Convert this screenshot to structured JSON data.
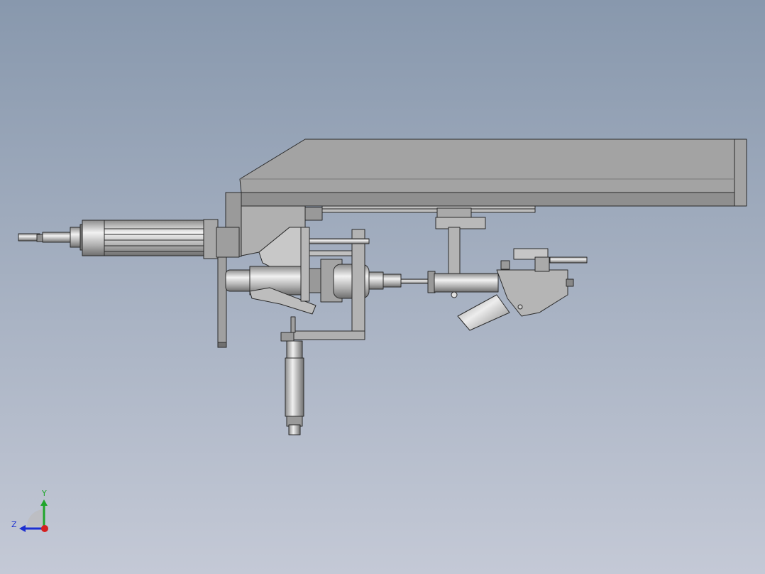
{
  "viewport": {
    "background_top_color": "#8898ad",
    "background_bottom_color": "#c4c9d6"
  },
  "triad": {
    "y_label": "Y",
    "z_label": "Z",
    "y_color": "#1fa52b",
    "z_color": "#1c2fd0",
    "x_color": "#d41f1f"
  },
  "model": {
    "fill_light": "#b7b9bb",
    "fill_mid": "#9c9c9c",
    "fill_dark": "#6a6a6a",
    "edge_color": "#2a2a2a"
  }
}
